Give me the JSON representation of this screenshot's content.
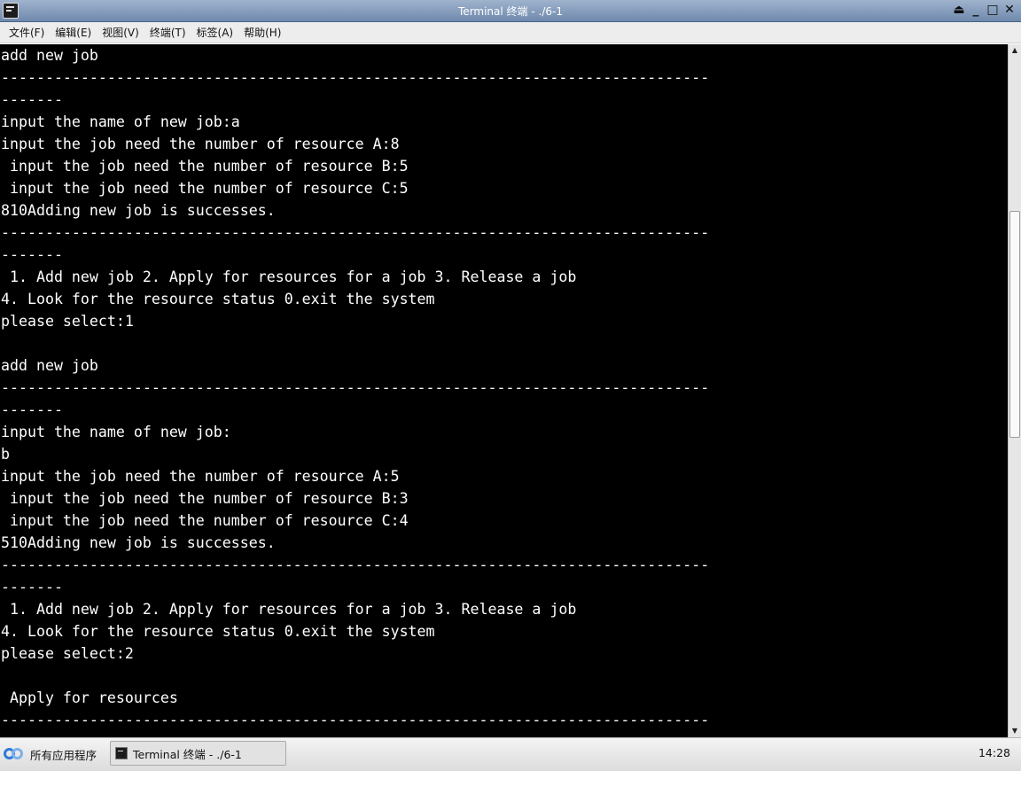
{
  "window": {
    "title": "Terminal 终端 - ./6-1",
    "controls": [
      "⏏",
      "_",
      "□",
      "✕"
    ]
  },
  "menu": [
    "文件(F)",
    "编辑(E)",
    "视图(V)",
    "终端(T)",
    "标签(A)",
    "帮助(H)"
  ],
  "terminal": {
    "lines": [
      "add new job",
      "--------------------------------------------------------------------------------",
      "-------",
      "input the name of new job:a",
      "input the job need the number of resource A:8",
      " input the job need the number of resource B:5",
      " input the job need the number of resource C:5",
      "810Adding new job is successes.",
      "--------------------------------------------------------------------------------",
      "-------",
      " 1. Add new job 2. Apply for resources for a job 3. Release a job",
      "4. Look for the resource status 0.exit the system",
      "please select:1",
      "",
      "add new job",
      "--------------------------------------------------------------------------------",
      "-------",
      "input the name of new job:",
      "b",
      "input the job need the number of resource A:5",
      " input the job need the number of resource B:3",
      " input the job need the number of resource C:4",
      "510Adding new job is successes.",
      "--------------------------------------------------------------------------------",
      "-------",
      " 1. Add new job 2. Apply for resources for a job 3. Release a job",
      "4. Look for the resource status 0.exit the system",
      "please select:2",
      "",
      " Apply for resources",
      "--------------------------------------------------------------------------------"
    ]
  },
  "taskbar": {
    "start_label": "所有应用程序",
    "window_label": "Terminal 终端 - ./6-1",
    "clock": "14:28"
  }
}
